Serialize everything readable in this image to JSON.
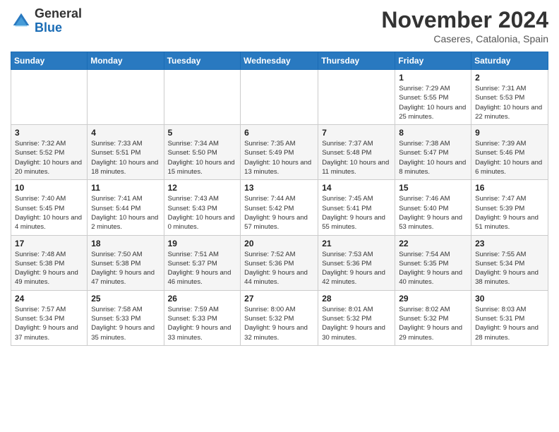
{
  "header": {
    "logo_general": "General",
    "logo_blue": "Blue",
    "month": "November 2024",
    "location": "Caseres, Catalonia, Spain"
  },
  "weekdays": [
    "Sunday",
    "Monday",
    "Tuesday",
    "Wednesday",
    "Thursday",
    "Friday",
    "Saturday"
  ],
  "weeks": [
    [
      {
        "day": "",
        "info": ""
      },
      {
        "day": "",
        "info": ""
      },
      {
        "day": "",
        "info": ""
      },
      {
        "day": "",
        "info": ""
      },
      {
        "day": "",
        "info": ""
      },
      {
        "day": "1",
        "info": "Sunrise: 7:29 AM\nSunset: 5:55 PM\nDaylight: 10 hours and 25 minutes."
      },
      {
        "day": "2",
        "info": "Sunrise: 7:31 AM\nSunset: 5:53 PM\nDaylight: 10 hours and 22 minutes."
      }
    ],
    [
      {
        "day": "3",
        "info": "Sunrise: 7:32 AM\nSunset: 5:52 PM\nDaylight: 10 hours and 20 minutes."
      },
      {
        "day": "4",
        "info": "Sunrise: 7:33 AM\nSunset: 5:51 PM\nDaylight: 10 hours and 18 minutes."
      },
      {
        "day": "5",
        "info": "Sunrise: 7:34 AM\nSunset: 5:50 PM\nDaylight: 10 hours and 15 minutes."
      },
      {
        "day": "6",
        "info": "Sunrise: 7:35 AM\nSunset: 5:49 PM\nDaylight: 10 hours and 13 minutes."
      },
      {
        "day": "7",
        "info": "Sunrise: 7:37 AM\nSunset: 5:48 PM\nDaylight: 10 hours and 11 minutes."
      },
      {
        "day": "8",
        "info": "Sunrise: 7:38 AM\nSunset: 5:47 PM\nDaylight: 10 hours and 8 minutes."
      },
      {
        "day": "9",
        "info": "Sunrise: 7:39 AM\nSunset: 5:46 PM\nDaylight: 10 hours and 6 minutes."
      }
    ],
    [
      {
        "day": "10",
        "info": "Sunrise: 7:40 AM\nSunset: 5:45 PM\nDaylight: 10 hours and 4 minutes."
      },
      {
        "day": "11",
        "info": "Sunrise: 7:41 AM\nSunset: 5:44 PM\nDaylight: 10 hours and 2 minutes."
      },
      {
        "day": "12",
        "info": "Sunrise: 7:43 AM\nSunset: 5:43 PM\nDaylight: 10 hours and 0 minutes."
      },
      {
        "day": "13",
        "info": "Sunrise: 7:44 AM\nSunset: 5:42 PM\nDaylight: 9 hours and 57 minutes."
      },
      {
        "day": "14",
        "info": "Sunrise: 7:45 AM\nSunset: 5:41 PM\nDaylight: 9 hours and 55 minutes."
      },
      {
        "day": "15",
        "info": "Sunrise: 7:46 AM\nSunset: 5:40 PM\nDaylight: 9 hours and 53 minutes."
      },
      {
        "day": "16",
        "info": "Sunrise: 7:47 AM\nSunset: 5:39 PM\nDaylight: 9 hours and 51 minutes."
      }
    ],
    [
      {
        "day": "17",
        "info": "Sunrise: 7:48 AM\nSunset: 5:38 PM\nDaylight: 9 hours and 49 minutes."
      },
      {
        "day": "18",
        "info": "Sunrise: 7:50 AM\nSunset: 5:38 PM\nDaylight: 9 hours and 47 minutes."
      },
      {
        "day": "19",
        "info": "Sunrise: 7:51 AM\nSunset: 5:37 PM\nDaylight: 9 hours and 46 minutes."
      },
      {
        "day": "20",
        "info": "Sunrise: 7:52 AM\nSunset: 5:36 PM\nDaylight: 9 hours and 44 minutes."
      },
      {
        "day": "21",
        "info": "Sunrise: 7:53 AM\nSunset: 5:36 PM\nDaylight: 9 hours and 42 minutes."
      },
      {
        "day": "22",
        "info": "Sunrise: 7:54 AM\nSunset: 5:35 PM\nDaylight: 9 hours and 40 minutes."
      },
      {
        "day": "23",
        "info": "Sunrise: 7:55 AM\nSunset: 5:34 PM\nDaylight: 9 hours and 38 minutes."
      }
    ],
    [
      {
        "day": "24",
        "info": "Sunrise: 7:57 AM\nSunset: 5:34 PM\nDaylight: 9 hours and 37 minutes."
      },
      {
        "day": "25",
        "info": "Sunrise: 7:58 AM\nSunset: 5:33 PM\nDaylight: 9 hours and 35 minutes."
      },
      {
        "day": "26",
        "info": "Sunrise: 7:59 AM\nSunset: 5:33 PM\nDaylight: 9 hours and 33 minutes."
      },
      {
        "day": "27",
        "info": "Sunrise: 8:00 AM\nSunset: 5:32 PM\nDaylight: 9 hours and 32 minutes."
      },
      {
        "day": "28",
        "info": "Sunrise: 8:01 AM\nSunset: 5:32 PM\nDaylight: 9 hours and 30 minutes."
      },
      {
        "day": "29",
        "info": "Sunrise: 8:02 AM\nSunset: 5:32 PM\nDaylight: 9 hours and 29 minutes."
      },
      {
        "day": "30",
        "info": "Sunrise: 8:03 AM\nSunset: 5:31 PM\nDaylight: 9 hours and 28 minutes."
      }
    ]
  ]
}
